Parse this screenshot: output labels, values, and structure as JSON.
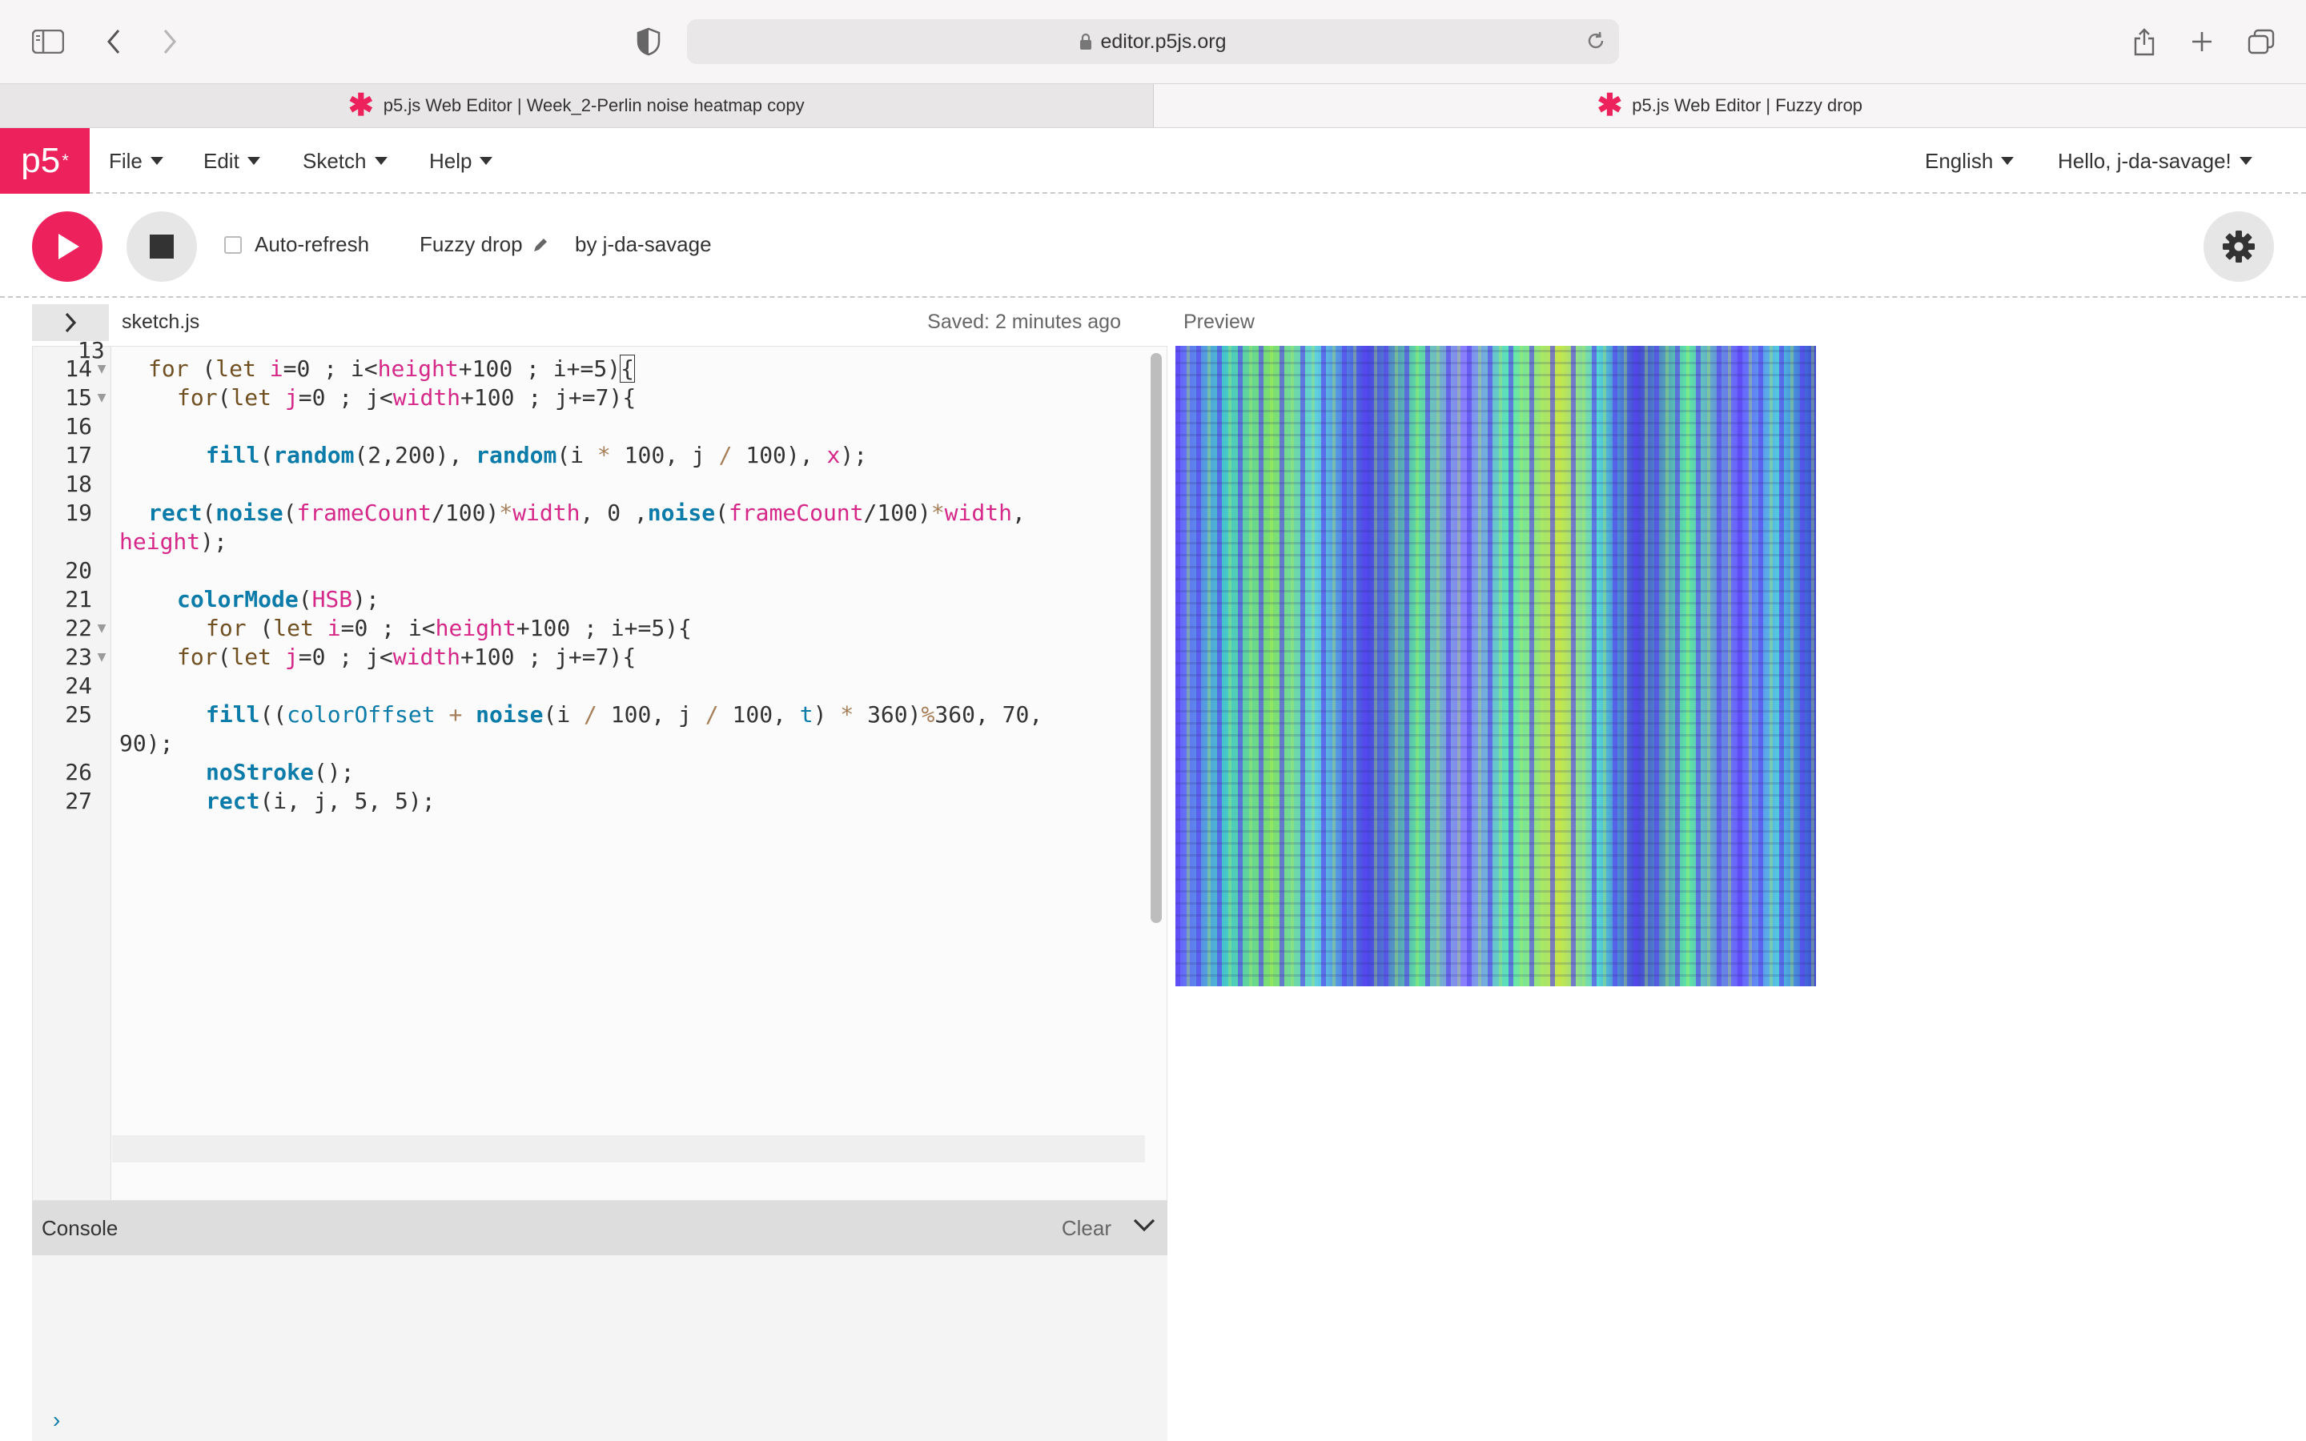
{
  "browser": {
    "url": "editor.p5js.org",
    "tabs": [
      {
        "label": "p5.js Web Editor | Week_2-Perlin noise heatmap copy",
        "active": false
      },
      {
        "label": "p5.js Web Editor | Fuzzy drop",
        "active": true
      }
    ]
  },
  "nav": {
    "logo": "p5",
    "logo_sup": "*",
    "menus": [
      "File",
      "Edit",
      "Sketch",
      "Help"
    ],
    "language": "English",
    "user": "Hello, j-da-savage!"
  },
  "toolbar": {
    "auto_refresh_label": "Auto-refresh",
    "sketch_name": "Fuzzy drop",
    "author": "by j-da-savage"
  },
  "editor": {
    "filename": "sketch.js",
    "saved_status": "Saved: 2 minutes ago",
    "preview_label": "Preview",
    "line_numbers": [
      "14",
      "15",
      "16",
      "17",
      "18",
      "19",
      "20",
      "21",
      "22",
      "23",
      "24",
      "25",
      "26",
      "27"
    ]
  },
  "console": {
    "title": "Console",
    "clear_label": "Clear",
    "prompt": "›"
  },
  "colors": {
    "accent": "#ed225d",
    "keyword": "#704f21",
    "function": "#0b7ca9",
    "variable": "#d52889"
  }
}
